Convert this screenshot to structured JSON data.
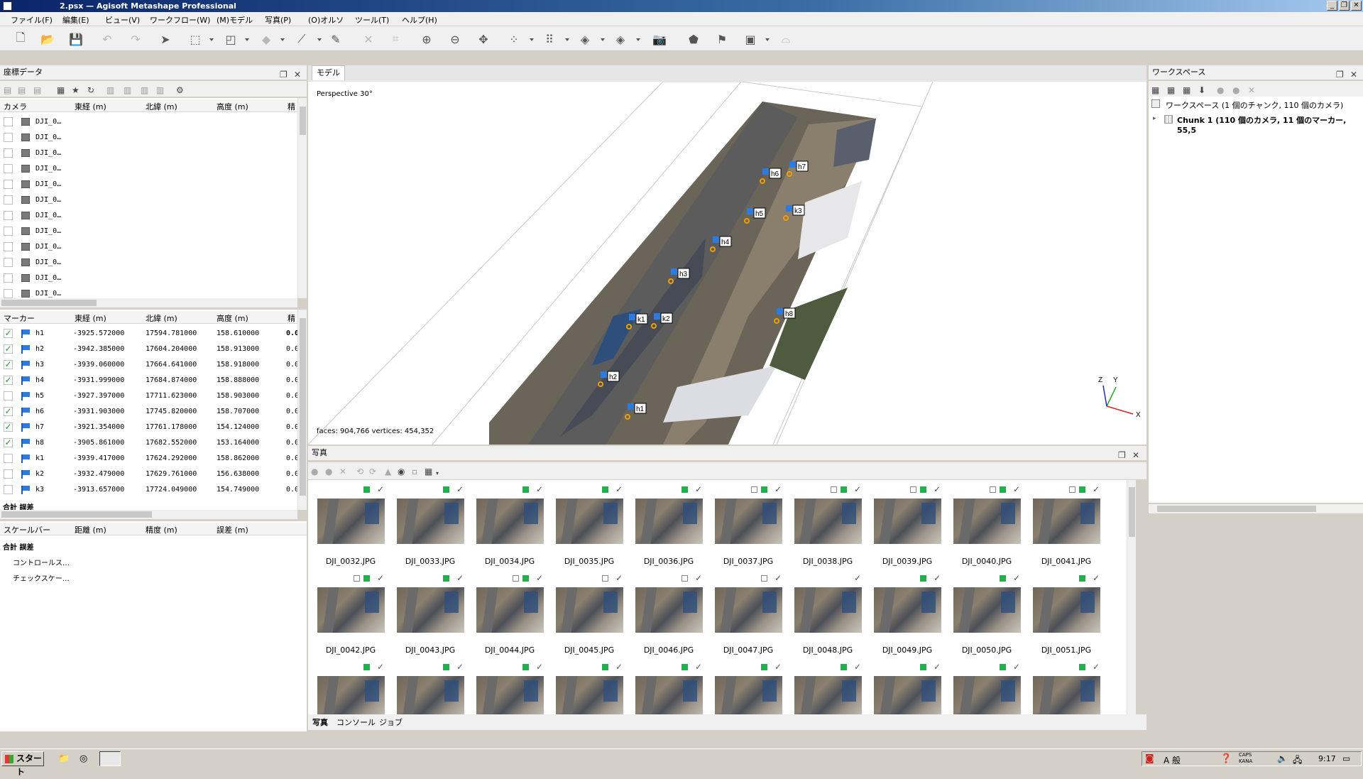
{
  "window": {
    "title": "2.psx — Agisoft Metashape Professional",
    "min": "_",
    "max": "❐",
    "close": "✕"
  },
  "menu": [
    "ファイル(F)",
    "編集(E)",
    "ビュー(V)",
    "ワークフロー(W)",
    "(M)モデル",
    "写真(P)",
    "(O)オルソ",
    "ツール(T)",
    "ヘルプ(H)"
  ],
  "reference": {
    "title": "座標データ",
    "camera_headers": [
      "カメラ",
      "東経 (m)",
      "北緯 (m)",
      "高度 (m)",
      "精"
    ],
    "cameras": [
      "DJI_0…",
      "DJI_0…",
      "DJI_0…",
      "DJI_0…",
      "DJI_0…",
      "DJI_0…",
      "DJI_0…",
      "DJI_0…",
      "DJI_0…",
      "DJI_0…",
      "DJI_0…",
      "DJI_0…"
    ],
    "marker_headers": [
      "マーカー",
      "東経 (m)",
      "北緯 (m)",
      "高度 (m)",
      "精"
    ],
    "markers": [
      {
        "checked": "✓",
        "name": "h1",
        "east": "-3925.572000",
        "north": "17594.781000",
        "alt": "158.610000",
        "acc": "0.0"
      },
      {
        "checked": "✓",
        "name": "h2",
        "east": "-3942.385000",
        "north": "17604.204000",
        "alt": "158.913000",
        "acc": "0.0"
      },
      {
        "checked": "✓",
        "name": "h3",
        "east": "-3939.060000",
        "north": "17664.641000",
        "alt": "158.918000",
        "acc": "0.0"
      },
      {
        "checked": "✓",
        "name": "h4",
        "east": "-3931.999000",
        "north": "17684.874000",
        "alt": "158.888000",
        "acc": "0.0"
      },
      {
        "checked": "",
        "name": "h5",
        "east": "-3927.397000",
        "north": "17711.623000",
        "alt": "158.903000",
        "acc": "0.0"
      },
      {
        "checked": "✓",
        "name": "h6",
        "east": "-3931.903000",
        "north": "17745.820000",
        "alt": "158.707000",
        "acc": "0.0"
      },
      {
        "checked": "✓",
        "name": "h7",
        "east": "-3921.354000",
        "north": "17761.178000",
        "alt": "154.124000",
        "acc": "0.0"
      },
      {
        "checked": "✓",
        "name": "h8",
        "east": "-3905.861000",
        "north": "17682.552000",
        "alt": "153.164000",
        "acc": "0.0"
      },
      {
        "checked": "",
        "name": "k1",
        "east": "-3939.417000",
        "north": "17624.292000",
        "alt": "158.862000",
        "acc": "0.0"
      },
      {
        "checked": "",
        "name": "k2",
        "east": "-3932.479000",
        "north": "17629.761000",
        "alt": "156.638000",
        "acc": "0.0"
      },
      {
        "checked": "",
        "name": "k3",
        "east": "-3913.657000",
        "north": "17724.049000",
        "alt": "154.749000",
        "acc": "0.0"
      }
    ],
    "marker_total": "合計 誤差",
    "scalebar_headers": [
      "スケールバー",
      "距離 (m)",
      "精度 (m)",
      "誤差 (m)"
    ],
    "scalebar_total": "合計 誤差",
    "scalebar_rows": [
      "コントロールス…",
      "チェックスケー…"
    ]
  },
  "model": {
    "tab": "モデル",
    "projection": "Perspective 30°",
    "stats": "faces: 904,766 vertices: 454,352",
    "markers": [
      "h1",
      "h2",
      "h3",
      "h4",
      "h5",
      "h6",
      "h7",
      "h8",
      "k1",
      "k2",
      "k3"
    ],
    "axes": {
      "z": "Z",
      "y": "Y",
      "x": "X"
    }
  },
  "workspace": {
    "title": "ワークスペース",
    "root": "ワークスペース (1 個のチャンク, 110 個のカメラ)",
    "chunk": "Chunk 1 (110 個のカメラ, 11 個のマーカー, 55,5"
  },
  "photos": {
    "title": "写真",
    "items": [
      {
        "name": "DJI_0032.JPG",
        "flags": "g"
      },
      {
        "name": "DJI_0033.JPG",
        "flags": "g"
      },
      {
        "name": "DJI_0034.JPG",
        "flags": "g"
      },
      {
        "name": "DJI_0035.JPG",
        "flags": "g"
      },
      {
        "name": "DJI_0036.JPG",
        "flags": "g"
      },
      {
        "name": "DJI_0037.JPG",
        "flags": "wg"
      },
      {
        "name": "DJI_0038.JPG",
        "flags": "wg"
      },
      {
        "name": "DJI_0039.JPG",
        "flags": "wg"
      },
      {
        "name": "DJI_0040.JPG",
        "flags": "wg"
      },
      {
        "name": "DJI_0041.JPG",
        "flags": "wg"
      },
      {
        "name": "DJI_0042.JPG",
        "flags": "wg"
      },
      {
        "name": "DJI_0043.JPG",
        "flags": "g"
      },
      {
        "name": "DJI_0044.JPG",
        "flags": "wg"
      },
      {
        "name": "DJI_0045.JPG",
        "flags": "w"
      },
      {
        "name": "DJI_0046.JPG",
        "flags": "w"
      },
      {
        "name": "DJI_0047.JPG",
        "flags": "w"
      },
      {
        "name": "DJI_0048.JPG",
        "flags": ""
      },
      {
        "name": "DJI_0049.JPG",
        "flags": "g"
      },
      {
        "name": "DJI_0050.JPG",
        "flags": "g"
      },
      {
        "name": "DJI_0051.JPG",
        "flags": "g"
      },
      {
        "name": "",
        "flags": "g"
      },
      {
        "name": "",
        "flags": "g"
      },
      {
        "name": "",
        "flags": "g"
      },
      {
        "name": "",
        "flags": "g"
      },
      {
        "name": "",
        "flags": "g"
      },
      {
        "name": "",
        "flags": "g"
      },
      {
        "name": "",
        "flags": "g"
      },
      {
        "name": "",
        "flags": "g"
      },
      {
        "name": "",
        "flags": "g"
      },
      {
        "name": "",
        "flags": "g"
      }
    ],
    "bottom_tabs": [
      "写真",
      "コンソール",
      "ジョブ"
    ]
  },
  "taskbar": {
    "start": "スタート",
    "ime": "A 般",
    "caps": "CAPS",
    "kana": "KANA",
    "clock": "9:17"
  }
}
